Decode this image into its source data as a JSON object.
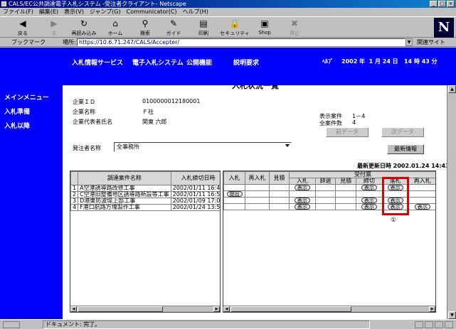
{
  "window": {
    "title": "CALS/EC公共調達電子入札システム -受注者クライアント- Netscape",
    "buttons": [
      "_",
      "□",
      "×"
    ]
  },
  "menu": [
    "ファイル(F)",
    "編集(E)",
    "表示(V)",
    "ジャンプ(G)",
    "Communicator(C)",
    "ヘルプ(H)"
  ],
  "toolbar": [
    {
      "label": "戻る",
      "icon": "back-arrow-icon",
      "glyph": "◀"
    },
    {
      "label": "次",
      "icon": "forward-arrow-icon",
      "glyph": "▶",
      "disabled": true
    },
    {
      "label": "再読み込み",
      "icon": "reload-icon",
      "glyph": "↻"
    },
    {
      "label": "ホーム",
      "icon": "home-icon",
      "glyph": "⌂"
    },
    {
      "label": "検索",
      "icon": "search-icon",
      "glyph": "⚲"
    },
    {
      "label": "ガイド",
      "icon": "guide-icon",
      "glyph": "✎"
    },
    {
      "label": "印刷",
      "icon": "print-icon",
      "glyph": "▤"
    },
    {
      "label": "セキュリティ",
      "icon": "security-icon",
      "glyph": "🔒"
    },
    {
      "label": "Shop",
      "icon": "shop-icon",
      "glyph": "▣"
    },
    {
      "label": "停止",
      "icon": "stop-icon",
      "glyph": "✖",
      "disabled": true
    }
  ],
  "location": {
    "bookmark_label": "ブックマーク",
    "label": "場所:",
    "url": "https://10.6.71.247/CALS/Accepter/",
    "related_label": "関連サイト"
  },
  "nav": {
    "links": [
      "入札情報サービス",
      "電子入札システム",
      "公開機能",
      "説明要求"
    ],
    "help": "ﾍﾙﾌﾟ",
    "date": "2002 年  1 月 24 日   14 時 43 分"
  },
  "sidebar": [
    "メインメニュー",
    "入札準備",
    "入札以降"
  ],
  "page": {
    "title": "入札状況一覧",
    "company_id_label": "企業ＩＤ",
    "company_id": "0100000012180001",
    "company_name_label": "企業名称",
    "company_name": "Ｆ社",
    "rep_label": "企業代表者氏名",
    "rep": "関東 六郎",
    "display_cases_label": "表示案件",
    "display_cases": "1－4",
    "total_cases_label": "全案件数",
    "total_cases": "4",
    "prev_label": "前データ",
    "next_label": "次データ",
    "office_label": "発注者名称",
    "office_value": "全事務所",
    "latest_label": "最新情報",
    "update_label": "最新更新日時",
    "update_value": "2002.01.24 14:43"
  },
  "left_table": {
    "headers": [
      "",
      "調達案件名称",
      "入札締切日時"
    ],
    "rows": [
      [
        "1",
        "A空港誘導路改修工事",
        "2002/01/11 16:45"
      ],
      [
        "2",
        "C空港旧整備地区誘導路新設等工事",
        "2002/01/11 16:55"
      ],
      [
        "3",
        "D港東防波堤上部工事",
        "2002/01/09 17:00"
      ],
      [
        "4",
        "F港口航路方塊製作工事",
        "2002/01/24 13:50"
      ]
    ]
  },
  "right_table": {
    "group_header": "受付票",
    "headers": [
      "入札",
      "再入札",
      "見積",
      "入札",
      "辞退",
      "見積",
      "締切",
      "落札",
      "再入札"
    ],
    "submit_label": "提出",
    "show_label": "表示",
    "rows": [
      {
        "submit": false,
        "shows": [
          3,
          6,
          7
        ]
      },
      {
        "submit": true,
        "shows": []
      },
      {
        "submit": false,
        "shows": [
          3,
          6,
          7
        ]
      },
      {
        "submit": false,
        "shows": [
          3,
          6,
          7,
          8
        ]
      }
    ]
  },
  "annotation": "①",
  "status": "ドキュメント: 完了。"
}
